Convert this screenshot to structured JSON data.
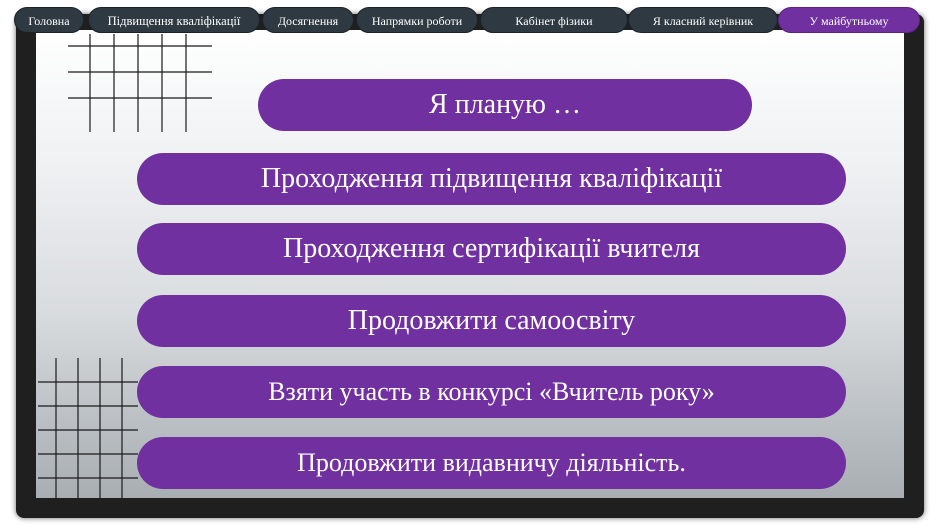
{
  "nav": {
    "tabs": [
      {
        "label": "Головна"
      },
      {
        "label": "Підвищення кваліфікації"
      },
      {
        "label": "Досягнення"
      },
      {
        "label": "Напрямки роботи"
      },
      {
        "label": "Кабінет фізики"
      },
      {
        "label": "Я класний керівник"
      },
      {
        "label": "У майбутньому",
        "active": true
      }
    ]
  },
  "main": {
    "heading": "Я планую …",
    "plans": [
      "Проходження підвищення кваліфікації",
      "Проходження сертифікації вчителя",
      "Продовжити самоосвіту",
      "Взяти участь в конкурсі «Вчитель року»",
      "Продовжити видавничу діяльність."
    ]
  },
  "colors": {
    "accent": "#7030a0",
    "tab_background": "#2f3942",
    "frame": "#1f1f1f"
  }
}
